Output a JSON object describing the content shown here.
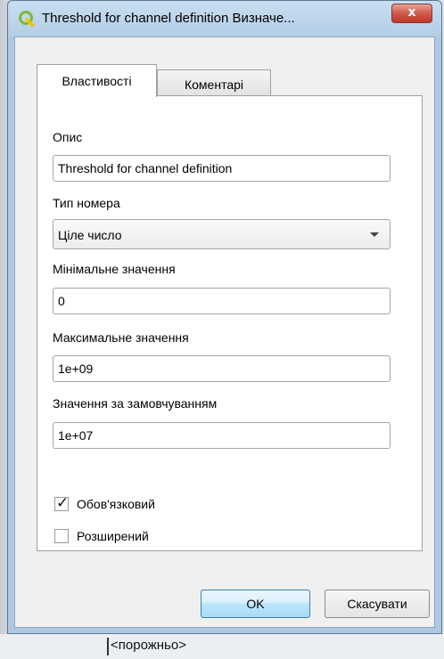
{
  "window": {
    "title": "Threshold for channel definition Визначе...",
    "close_symbol": "x",
    "app_icon": "qgis-logo-icon"
  },
  "tabs": [
    {
      "label": "Властивості",
      "active": true
    },
    {
      "label": "Коментарі",
      "active": false
    }
  ],
  "form": {
    "description_label": "Опис",
    "description_value": "Threshold for channel definition",
    "number_type_label": "Тип номера",
    "number_type_value": "Ціле число",
    "min_label": "Мінімальне значення",
    "min_value": "0",
    "max_label": "Максимальне значення",
    "max_value": "1e+09",
    "default_label": "Значення за замовчуванням",
    "default_value": "1e+07"
  },
  "checkboxes": {
    "mandatory": {
      "label": "Обов'язковий",
      "checked": true
    },
    "advanced": {
      "label": "Розширений",
      "checked": false
    }
  },
  "buttons": {
    "ok": "OK",
    "cancel": "Скасувати"
  },
  "background": {
    "item_text": "<порожньо>"
  },
  "colors": {
    "title_bar": "#b4cee7",
    "close_button": "#c0392b",
    "qgis_green": "#7fb83a"
  }
}
